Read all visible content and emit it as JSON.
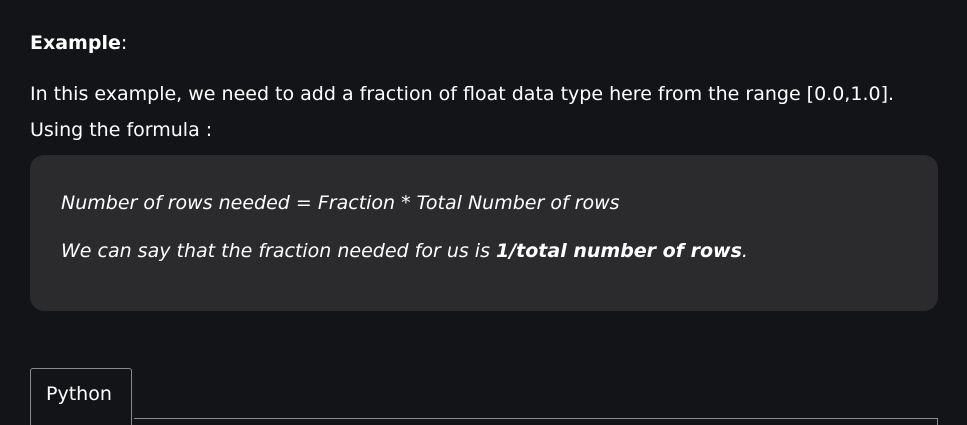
{
  "example": {
    "heading": "Example",
    "heading_suffix": ":"
  },
  "intro": {
    "line1": "In this example, we need to add a fraction of float data type here from the range [0.0,1.0].",
    "line2": "Using the formula :"
  },
  "quote": {
    "formula": "Number of rows needed = Fraction * Total Number of rows",
    "line2_prefix": "We can say that the fraction needed for us is ",
    "line2_bold": "1/total number of rows",
    "line2_suffix": "."
  },
  "tabs": [
    {
      "label": "Python",
      "active": true
    }
  ]
}
